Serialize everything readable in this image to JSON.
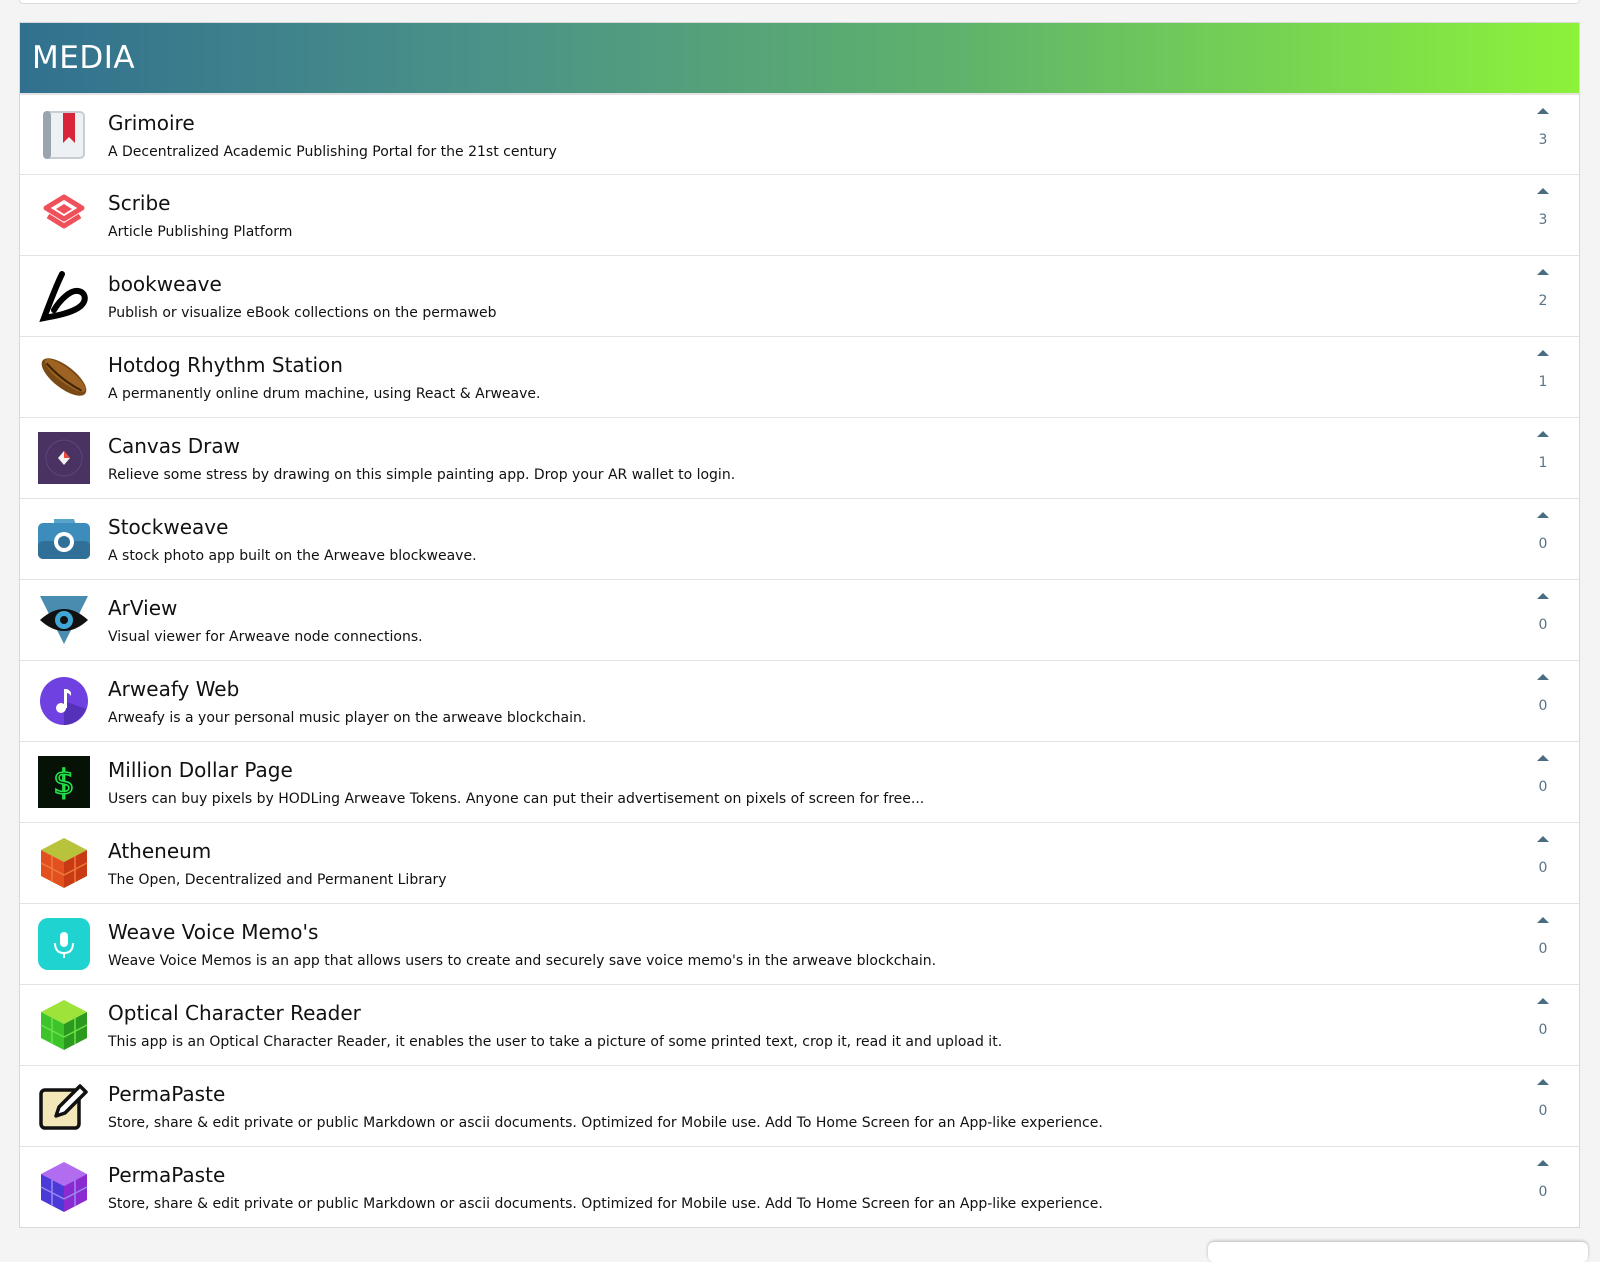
{
  "section": {
    "title": "MEDIA",
    "gradient": [
      "#32708f",
      "#8cf23a"
    ]
  },
  "apps": [
    {
      "name": "Grimoire",
      "description": "A Decentralized Academic Publishing Portal for the 21st century",
      "votes": "3",
      "icon": "book-bookmark-icon"
    },
    {
      "name": "Scribe",
      "description": "Article Publishing Platform",
      "votes": "3",
      "icon": "layers-icon"
    },
    {
      "name": "bookweave",
      "description": "Publish or visualize eBook collections on the permaweb",
      "votes": "2",
      "icon": "letter-b-icon"
    },
    {
      "name": "Hotdog Rhythm Station",
      "description": "A permanently online drum machine, using React & Arweave.",
      "votes": "1",
      "icon": "hotdog-icon"
    },
    {
      "name": "Canvas Draw",
      "description": "Relieve some stress by drawing on this simple painting app. Drop your AR wallet to login.",
      "votes": "1",
      "icon": "canvas-icon"
    },
    {
      "name": "Stockweave",
      "description": "A stock photo app built on the Arweave blockweave.",
      "votes": "0",
      "icon": "camera-icon"
    },
    {
      "name": "ArView",
      "description": "Visual viewer for Arweave node connections.",
      "votes": "0",
      "icon": "eye-icon"
    },
    {
      "name": "Arweafy Web",
      "description": "Arweafy is a your personal music player on the arweave blockchain.",
      "votes": "0",
      "icon": "music-note-icon"
    },
    {
      "name": "Million Dollar Page",
      "description": "Users can buy pixels by HODLing Arweave Tokens. Anyone can put their advertisement on pixels of screen for free...",
      "votes": "0",
      "icon": "dollar-sign-icon"
    },
    {
      "name": "Atheneum",
      "description": "The Open, Decentralized and Permanent Library",
      "votes": "0",
      "icon": "red-cube-icon"
    },
    {
      "name": "Weave Voice Memo's",
      "description": "Weave Voice Memos is an app that allows users to create and securely save voice memo's in the arweave blockchain.",
      "votes": "0",
      "icon": "microphone-icon"
    },
    {
      "name": "Optical Character Reader",
      "description": "This app is an Optical Character Reader, it enables the user to take a picture of some printed text, crop it, read it and upload it.",
      "votes": "0",
      "icon": "green-cube-icon"
    },
    {
      "name": "PermaPaste",
      "description": "Store, share & edit private or public Markdown or ascii documents. Optimized for Mobile use. Add To Home Screen for an App-like experience.",
      "votes": "0",
      "icon": "edit-pencil-icon"
    },
    {
      "name": "PermaPaste",
      "description": "Store, share & edit private or public Markdown or ascii documents. Optimized for Mobile use. Add To Home Screen for an App-like experience.",
      "votes": "0",
      "icon": "purple-cube-icon"
    }
  ]
}
